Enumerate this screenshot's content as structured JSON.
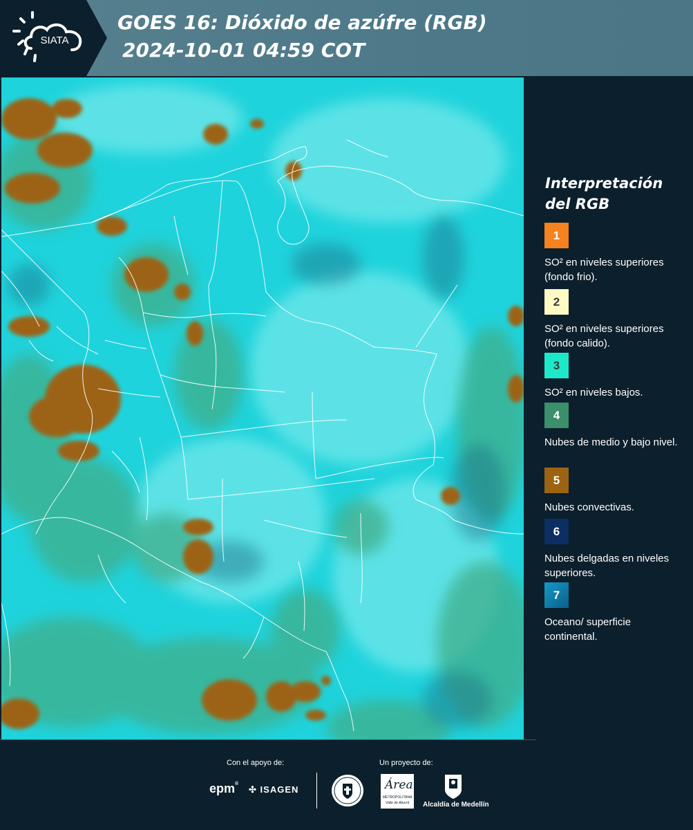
{
  "header": {
    "logo_text": "SIATA",
    "title_line1": "GOES 16: Dióxido de azúfre (RGB)",
    "title_line2": "2024-10-01 04:59 COT"
  },
  "legend": {
    "title_line1": "Interpretación",
    "title_line2": "del RGB",
    "items": [
      {
        "number": "1",
        "color": "#f5821f",
        "text_color": "#ffffff",
        "label": "SO² en niveles superiores (fondo frio)."
      },
      {
        "number": "2",
        "color": "#fff9c4",
        "text_color": "#3a3a3a",
        "label": "SO² en niveles superiores (fondo calido)."
      },
      {
        "number": "3",
        "color": "#1de9c8",
        "text_color": "#3a3a3a",
        "label": "SO² en niveles bajos."
      },
      {
        "number": "4",
        "color": "#3b8f6b",
        "text_color": "#ffffff",
        "label": "Nubes de medio y bajo nivel."
      },
      {
        "number": "5",
        "color": "#9c6412",
        "text_color": "#ffffff",
        "label": "Nubes convectivas."
      },
      {
        "number": "6",
        "color": "#0b2f63",
        "text_color": "#ffffff",
        "label": "Nubes delgadas en niveles superiores."
      },
      {
        "number": "7",
        "color": "#1a8fc2",
        "text_color": "#ffffff",
        "label": "Oceano/ superficie continental."
      }
    ]
  },
  "footer": {
    "support_caption": "Con el apoyo de:",
    "project_caption": "Un proyecto de:",
    "epm": "epm",
    "isagen": "ISAGEN",
    "area_name": "Área",
    "area_sub1": "METROPOLITANA",
    "area_sub2": "Valle de Aburrá",
    "alcaldia": "Alcaldía de Medellín"
  },
  "map_colors": {
    "background": "#1fd3dc",
    "convective": "#9c6412",
    "mid_low_clouds": "#3fae8a",
    "thin_clouds": "#1c6f86",
    "borders": "#ffffff"
  }
}
